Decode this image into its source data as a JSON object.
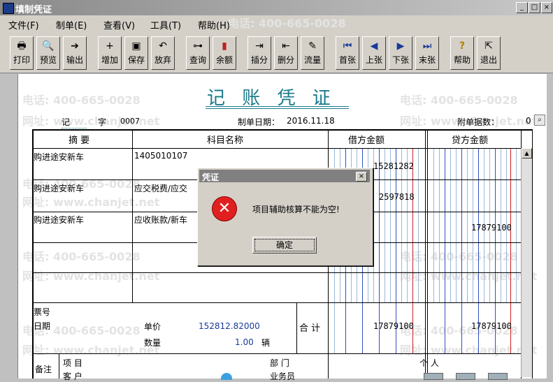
{
  "window": {
    "title": "填制凭证",
    "min_label": "_",
    "max_label": "□",
    "close_label": "×"
  },
  "menu": [
    {
      "label": "文件(F)"
    },
    {
      "label": "制单(E)"
    },
    {
      "label": "查看(V)"
    },
    {
      "label": "工具(T)"
    },
    {
      "label": "帮助(H)"
    }
  ],
  "toolbar": [
    {
      "label": "打印",
      "icon": "printer-icon",
      "glyph": "🖶"
    },
    {
      "label": "预览",
      "icon": "preview-icon",
      "glyph": "🔍"
    },
    {
      "label": "输出",
      "icon": "export-icon",
      "glyph": "➔"
    },
    {
      "label": "增加",
      "icon": "add-icon",
      "glyph": "+"
    },
    {
      "label": "保存",
      "icon": "save-icon",
      "glyph": "▣"
    },
    {
      "label": "放弃",
      "icon": "undo-icon",
      "glyph": "↶"
    },
    {
      "label": "查询",
      "icon": "binoculars-icon",
      "glyph": "⊶"
    },
    {
      "label": "余额",
      "icon": "balance-chart-icon",
      "glyph": "▮"
    },
    {
      "label": "插分",
      "icon": "insert-line-icon",
      "glyph": "⇥"
    },
    {
      "label": "删分",
      "icon": "delete-line-icon",
      "glyph": "⇤"
    },
    {
      "label": "流量",
      "icon": "cashflow-icon",
      "glyph": "✎"
    },
    {
      "label": "首张",
      "icon": "first-icon",
      "glyph": "⏮"
    },
    {
      "label": "上张",
      "icon": "prev-icon",
      "glyph": "◀"
    },
    {
      "label": "下张",
      "icon": "next-icon",
      "glyph": "▶"
    },
    {
      "label": "末张",
      "icon": "last-icon",
      "glyph": "⏭"
    },
    {
      "label": "帮助",
      "icon": "help-icon",
      "glyph": "?"
    },
    {
      "label": "退出",
      "icon": "exit-icon",
      "glyph": "⇱"
    }
  ],
  "voucher": {
    "title": "记 账 凭 证",
    "type_label": "记",
    "number_label": "字",
    "number": "0007",
    "date_label": "制单日期：",
    "date": "2016.11.18",
    "attachments_label": "附单据数：",
    "attachments": "0",
    "columns": {
      "summary": "摘 要",
      "account": "科目名称",
      "debit": "借方金额",
      "credit": "贷方金额"
    },
    "rows": [
      {
        "summary": "购进途安新车",
        "account": "1405010107",
        "debit": "15281282",
        "credit": ""
      },
      {
        "summary": "购进途安新车",
        "account": "应交税费/应交",
        "debit": "2597818",
        "credit": ""
      },
      {
        "summary": "购进途安新车",
        "account": "应收账款/新车",
        "debit": "",
        "credit": "17879100"
      }
    ],
    "ticket_label": "票号",
    "date_row_label": "日期",
    "unit_price_label": "单价",
    "unit_price": "152812.82000",
    "quantity_label": "数量",
    "quantity": "1.00",
    "quantity_unit": "辆",
    "total_label": "合 计",
    "total_debit": "17879100",
    "total_credit": "17879100",
    "remarks_label": "备注",
    "project_label": "项 目",
    "customer_label": "客 户",
    "department_label": "部 门",
    "person_label": "个 人",
    "salesperson_label": "业务员"
  },
  "watermarks": {
    "phone": "电话: 400-665-0028",
    "site": "网址: www.chanjet.net"
  },
  "dialog": {
    "title": "凭证",
    "close_label": "×",
    "message": "项目辅助核算不能为空!",
    "ok_label": "确定"
  },
  "colors": {
    "title_teal": "#1a7a8a",
    "error_red": "#e02020",
    "grid_blue": "#3050c0",
    "grid_red": "#d02020"
  }
}
